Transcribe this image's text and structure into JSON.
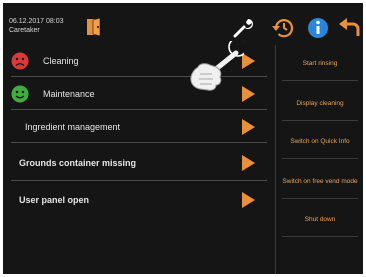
{
  "header": {
    "datetime": "06.12.2017 08:03",
    "role": "Caretaker"
  },
  "menu": {
    "items": [
      {
        "label": "Cleaning",
        "status": "red"
      },
      {
        "label": "Maintenance",
        "status": "green"
      },
      {
        "label": "Ingredient management"
      },
      {
        "label": "Grounds container missing"
      },
      {
        "label": "User panel open"
      }
    ]
  },
  "actions": {
    "start_rinsing": "Start rinsing",
    "display_cleaning": "Display cleaning",
    "switch_quick_info": "Switch on Quick Info",
    "switch_free_vend": "Switch on free vend mode",
    "shut_down": "Shut down"
  },
  "colors": {
    "background": "#151515",
    "accent": "#e9913a",
    "status_red": "#d83a3a",
    "status_green": "#3fae3f",
    "info_blue": "#2a86d8"
  },
  "icons": [
    "door-icon",
    "wrench-icon",
    "history-icon",
    "info-icon",
    "back-arrow-icon",
    "hand-pointer-icon",
    "sad-face-icon",
    "happy-face-icon",
    "chevron-right-icon"
  ]
}
